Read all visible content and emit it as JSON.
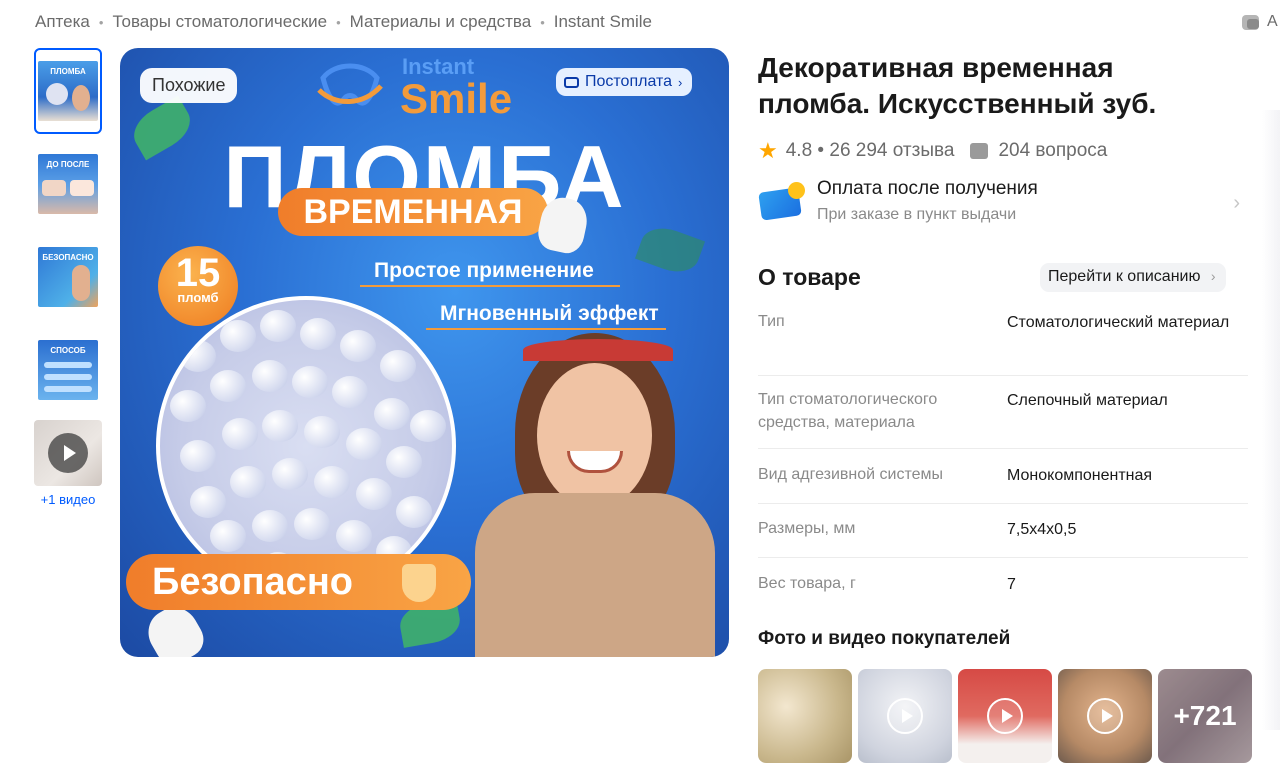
{
  "breadcrumb": [
    {
      "label": "Аптека"
    },
    {
      "label": "Товары стоматологические"
    },
    {
      "label": "Материалы и средства"
    },
    {
      "label": "Instant Smile"
    }
  ],
  "top_right": {
    "label": "А"
  },
  "gallery": {
    "thumbnails": [
      {
        "caption": "ПЛОМБА"
      },
      {
        "caption": "ДО  ПОСЛЕ"
      },
      {
        "caption": "БЕЗОПАСНО"
      },
      {
        "caption": "СПОСОБ"
      }
    ],
    "video_label": "+1 видео",
    "similar_button": "Похожие",
    "postpay_button": "Постоплата",
    "image": {
      "brand_line1": "Instant",
      "brand_line2": "Smile",
      "headline": "ПЛОМБА",
      "subheadline": "ВРЕМЕННАЯ",
      "count_number": "15",
      "count_unit": "пломб",
      "feature1": "Простое применение",
      "feature2": "Мгновенный эффект",
      "safe_label": "Безопасно"
    }
  },
  "product": {
    "title": "Декоративная временная пломба. Искусственный зуб.",
    "rating": "4.8",
    "reviews": "26 294 отзыва",
    "questions": "204 вопроса"
  },
  "payment": {
    "title": "Оплата после получения",
    "subtitle": "При заказе в пункт выдачи"
  },
  "about": {
    "title": "О товаре",
    "goto_label": "Перейти к описанию",
    "specs": [
      {
        "key": "Тип",
        "value": "Стоматологический материал"
      },
      {
        "key": "Тип стоматологического средства, материала",
        "value": "Слепочный материал"
      },
      {
        "key": "Вид адгезивной системы",
        "value": "Монокомпонентная"
      },
      {
        "key": "Размеры, мм",
        "value": "7,5x4x0,5"
      },
      {
        "key": "Вес товара, г",
        "value": "7"
      }
    ]
  },
  "customer_media": {
    "title": "Фото и видео покупателей",
    "more_count": "+721"
  },
  "colors": {
    "accent": "#005bff",
    "orange": "#f39b3b",
    "star": "#ffa600"
  }
}
